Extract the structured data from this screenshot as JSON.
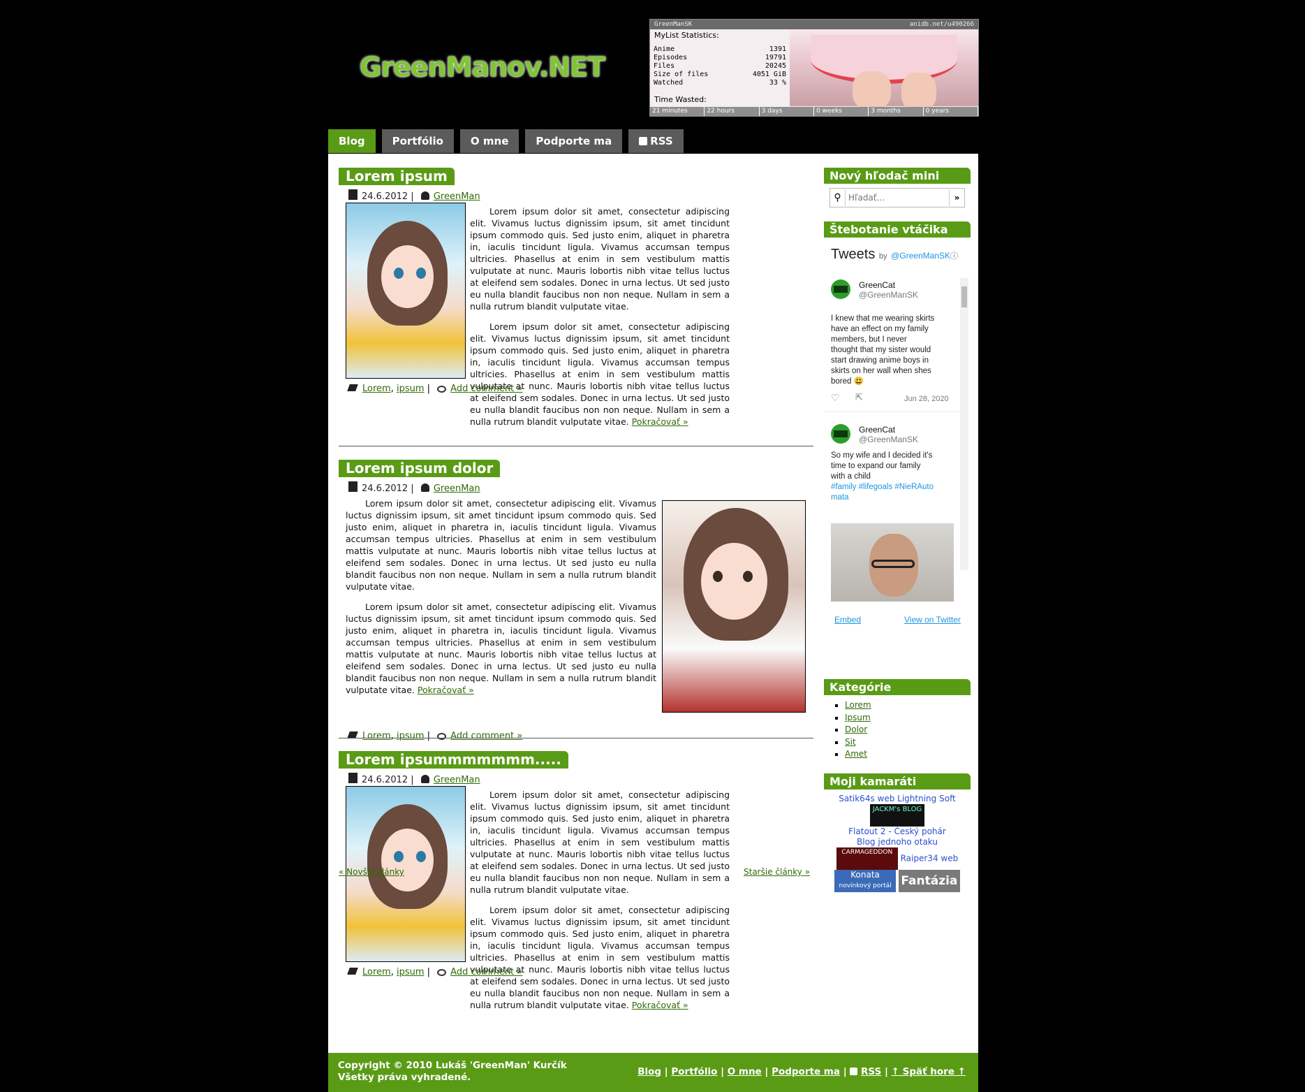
{
  "header": {
    "logo": "GreenManov.NET"
  },
  "stats": {
    "user": "GreenManSK",
    "url": "anidb.net/u490266",
    "title": "MyList Statistics:",
    "rows": [
      {
        "label": "Anime",
        "value": "1391"
      },
      {
        "label": "Episodes",
        "value": "19791"
      },
      {
        "label": "Files",
        "value": "20245"
      },
      {
        "label": "Size of files",
        "value": "4051 GiB"
      },
      {
        "label": "Watched",
        "value": "33 %"
      }
    ],
    "time_label": "Time Wasted:",
    "timeline": [
      "21 minutes",
      "22 hours",
      "3 days",
      "0 weeks",
      "3 months",
      "0 years"
    ],
    "watched_fraction": 0.33
  },
  "nav": {
    "items": [
      "Blog",
      "Portfólio",
      "O mne",
      "Podporte ma",
      "RSS"
    ]
  },
  "posts": [
    {
      "title": "Lorem ipsum",
      "date": "24.6.2012",
      "author": "GreenMan",
      "p1": "Lorem ipsum dolor sit amet, consectetur adipiscing elit. Vivamus luctus dignissim ipsum, sit amet tincidunt ipsum commodo quis. Sed justo enim, aliquet in pharetra in, iaculis tincidunt ligula. Vivamus accumsan tempus ultricies. Phasellus at enim in sem vestibulum mattis vulputate at nunc. Mauris lobortis nibh vitae tellus luctus at eleifend sem sodales. Donec in urna lectus. Ut sed justo eu nulla blandit faucibus non non neque. Nullam in sem a nulla rutrum blandit vulputate vitae.",
      "p2": "Lorem ipsum dolor sit amet, consectetur adipiscing elit. Vivamus luctus dignissim ipsum, sit amet tincidunt ipsum commodo quis. Sed justo enim, aliquet in pharetra in, iaculis tincidunt ligula. Vivamus accumsan tempus ultricies. Phasellus at enim in sem vestibulum mattis vulputate at nunc. Mauris lobortis nibh vitae tellus luctus at eleifend sem sodales. Donec in urna lectus. Ut sed justo eu nulla blandit faucibus non non neque. Nullam in sem a nulla rutrum blandit vulputate vitae.",
      "more": "Pokračovať »",
      "tag1": "Lorem",
      "tag2": "ipsum",
      "comment": "Add comment »"
    },
    {
      "title": "Lorem ipsum dolor",
      "date": "24.6.2012",
      "author": "GreenMan",
      "p1": "Lorem ipsum dolor sit amet, consectetur adipiscing elit. Vivamus luctus dignissim ipsum, sit amet tincidunt ipsum commodo quis. Sed justo enim, aliquet in pharetra in, iaculis tincidunt ligula. Vivamus accumsan tempus ultricies. Phasellus at enim in sem vestibulum mattis vulputate at nunc. Mauris lobortis nibh vitae tellus luctus at eleifend sem sodales. Donec in urna lectus. Ut sed justo eu nulla blandit faucibus non non neque. Nullam in sem a nulla rutrum blandit vulputate vitae.",
      "p2": "Lorem ipsum dolor sit amet, consectetur adipiscing elit. Vivamus luctus dignissim ipsum, sit amet tincidunt ipsum commodo quis. Sed justo enim, aliquet in pharetra in, iaculis tincidunt ligula. Vivamus accumsan tempus ultricies. Phasellus at enim in sem vestibulum mattis vulputate at nunc. Mauris lobortis nibh vitae tellus luctus at eleifend sem sodales. Donec in urna lectus. Ut sed justo eu nulla blandit faucibus non non neque. Nullam in sem a nulla rutrum blandit vulputate vitae.",
      "more": "Pokračovať »",
      "tag1": "Lorem",
      "tag2": "ipsum",
      "comment": "Add comment »"
    },
    {
      "title": "Lorem ipsummmmmmm.....",
      "date": "24.6.2012",
      "author": "GreenMan",
      "p1": "Lorem ipsum dolor sit amet, consectetur adipiscing elit. Vivamus luctus dignissim ipsum, sit amet tincidunt ipsum commodo quis. Sed justo enim, aliquet in pharetra in, iaculis tincidunt ligula. Vivamus accumsan tempus ultricies. Phasellus at enim in sem vestibulum mattis vulputate at nunc. Mauris lobortis nibh vitae tellus luctus at eleifend sem sodales. Donec in urna lectus. Ut sed justo eu nulla blandit faucibus non non neque. Nullam in sem a nulla rutrum blandit vulputate vitae.",
      "p2": "Lorem ipsum dolor sit amet, consectetur adipiscing elit. Vivamus luctus dignissim ipsum, sit amet tincidunt ipsum commodo quis. Sed justo enim, aliquet in pharetra in, iaculis tincidunt ligula. Vivamus accumsan tempus ultricies. Phasellus at enim in sem vestibulum mattis vulputate at nunc. Mauris lobortis nibh vitae tellus luctus at eleifend sem sodales. Donec in urna lectus. Ut sed justo eu nulla blandit faucibus non non neque. Nullam in sem a nulla rutrum blandit vulputate vitae.",
      "more": "Pokračovať »",
      "tag1": "Lorem",
      "tag2": "ipsum",
      "comment": "Add comment »"
    }
  ],
  "pager": {
    "newer": "« Novšie články",
    "older": "Staršie články »"
  },
  "sidebar": {
    "search_title": "Nový hľodač mini",
    "search_placeholder": "Hľadať…",
    "search_go": "»",
    "twitter_title": "Štebotanie vtáčika",
    "tw_heading": "Tweets",
    "tw_by": "by",
    "tw_handle": "@GreenManSK",
    "tw_info": "ⓘ",
    "tweets": [
      {
        "name": "GreenCat",
        "handle": "@GreenManSK",
        "text": "I knew that me wearing skirts have an effect on my family members, but I never thought that my sister would start drawing anime boys in skirts on her wall when shes bored 😃",
        "date": "Jun 28, 2020"
      },
      {
        "name": "GreenCat",
        "handle": "@GreenManSK",
        "text": "So my wife and I decided it's time to expand our family with a child",
        "tags": "#family #lifegoals #NieRAutomata"
      }
    ],
    "tw_embed": "Embed",
    "tw_view": "View on Twitter",
    "cat_title": "Kategórie",
    "categories": [
      "Lorem",
      "Ipsum",
      "Dolor",
      "Sit",
      "Amet"
    ],
    "friends_title": "Moji kamaráti",
    "friends": {
      "a": "Satik64s web",
      "b": "Lightning Soft",
      "c": "JACKM's BLOG",
      "d": "Flatout 2 - Český pohár",
      "e": "Blog jednoho otaku",
      "f": "CARMAGEDDON",
      "g": "Raiper34 web",
      "h": "Konata",
      "h2": "novinkový portál",
      "i": "Fantázia"
    }
  },
  "footer": {
    "copy1": "Copyright © 2010 Lukáš 'GreenMan' Kurčík",
    "copy2": "Všetky práva vyhradené.",
    "links": [
      "Blog",
      "Portfólio",
      "O mne",
      "Podporte ma",
      "RSS",
      "↑ Späť hore ↑"
    ],
    "sep": "|"
  }
}
